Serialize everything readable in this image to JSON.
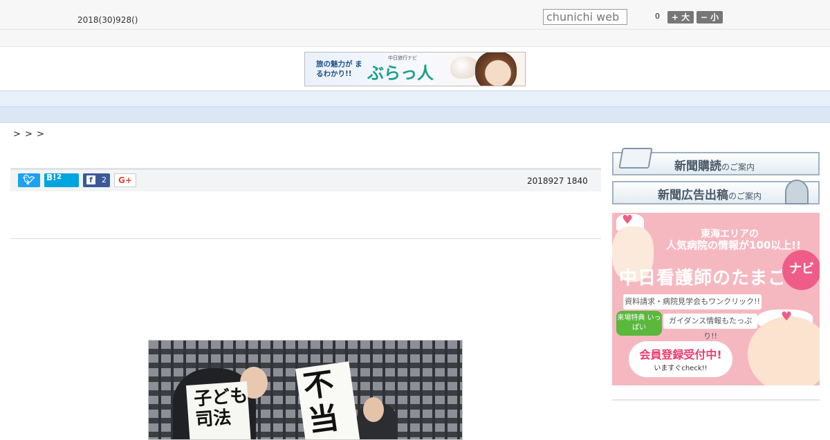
{
  "header": {
    "date": "2018(30)928()",
    "search_placeholder": "chunichi web",
    "font_count": "0",
    "font_up_label": "+ 大",
    "font_down_label": "− 小"
  },
  "banner": {
    "tagline": "旅の魅力が まるわかり!!",
    "sub": "中日旅行ナビ",
    "brand": "ぶらっ人"
  },
  "nav": {
    "items": [
      "",
      "",
      "",
      "",
      "",
      "",
      "",
      "",
      ""
    ]
  },
  "breadcrumb": ">  >  >",
  "share": {
    "twitter_icon": "twitter-icon",
    "hatena_label": "B!",
    "hatena_count": "2",
    "facebook_label": "f",
    "facebook_count": "2",
    "gplus_label": "G+",
    "pubdate": "2018927 1840"
  },
  "photo": {
    "sign_left": "子ども 司法",
    "sign_right": "不当"
  },
  "sidebar": {
    "subscribe_main": "新聞購読",
    "subscribe_tail": "のご案内",
    "advert_main": "新聞広告出稿",
    "advert_tail": "のご案内",
    "nurse_ad": {
      "line1": "東海エリアの",
      "line2": "人気病院の情報が100以上!!",
      "title": "中日看護師のたまご",
      "navi": "ナビ",
      "pill1": "資料請求・病院見学会もワンクリック!!",
      "badge": "来場特典 いっぱい",
      "pill2": "ガイダンス情報もたっぷり!!",
      "register": "会員登録受付中!",
      "check": "いますぐcheck!!"
    }
  },
  "colors": {
    "nav_bg": "#e8f0f9",
    "twitter": "#1da1f2",
    "hatena": "#00a4de",
    "facebook": "#3b5998",
    "nurse_pink": "#f6b8c0"
  }
}
